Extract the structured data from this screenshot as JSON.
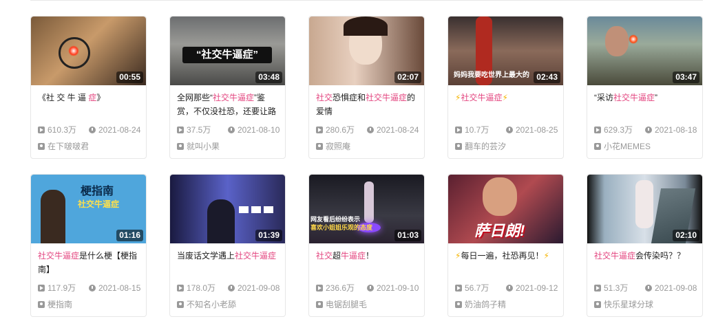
{
  "videos": [
    {
      "duration": "00:55",
      "title_parts": [
        {
          "t": "《社 交 牛 逼 "
        },
        {
          "t": "症",
          "h": true
        },
        {
          "t": "》"
        }
      ],
      "views": "610.3万",
      "date": "2021-08-24",
      "author": "在下啵啵君"
    },
    {
      "duration": "03:48",
      "thumb_caption": "“社交牛逼症”",
      "title_parts": [
        {
          "t": "全网那些“"
        },
        {
          "t": "社交牛逼症",
          "h": true
        },
        {
          "t": "”鉴赏，不仅没社恐，还要让路"
        }
      ],
      "views": "37.5万",
      "date": "2021-08-10",
      "author": "就叫小果"
    },
    {
      "duration": "02:07",
      "title_parts": [
        {
          "t": "社交",
          "h": true
        },
        {
          "t": "恐惧症和"
        },
        {
          "t": "社交牛逼症",
          "h": true
        },
        {
          "t": "的爱情"
        }
      ],
      "views": "280.6万",
      "date": "2021-08-24",
      "author": "寂照庵"
    },
    {
      "duration": "02:43",
      "thumb_caption": "妈妈我要吃世界上最大的",
      "title_parts": [
        {
          "t": "⚡",
          "b": true
        },
        {
          "t": "社交牛逼症",
          "h": true
        },
        {
          "t": "⚡",
          "b": true
        }
      ],
      "views": "10.7万",
      "date": "2021-08-25",
      "author": "翻车的芸汐"
    },
    {
      "duration": "03:47",
      "title_parts": [
        {
          "t": "“采访"
        },
        {
          "t": "社交牛逼症",
          "h": true
        },
        {
          "t": "”"
        }
      ],
      "views": "629.3万",
      "date": "2021-08-18",
      "author": "小花MEMES"
    },
    {
      "duration": "01:16",
      "thumb_caption": "梗指南",
      "thumb_caption2": "社交牛逼症",
      "title_parts": [
        {
          "t": "社交牛逼症",
          "h": true
        },
        {
          "t": "是什么梗【梗指南】"
        }
      ],
      "views": "117.9万",
      "date": "2021-08-15",
      "author": "梗指南"
    },
    {
      "duration": "01:39",
      "title_parts": [
        {
          "t": "当废话文学遇上"
        },
        {
          "t": "社交牛逼症",
          "h": true
        }
      ],
      "views": "178.0万",
      "date": "2021-09-08",
      "author": "不知名小老舔"
    },
    {
      "duration": "01:03",
      "thumb_caption": "网友看后纷纷表示",
      "thumb_caption2": "喜欢小姐姐乐观的态度",
      "title_parts": [
        {
          "t": "社交",
          "h": true
        },
        {
          "t": "超"
        },
        {
          "t": "牛逼症",
          "h": true
        },
        {
          "t": "！"
        }
      ],
      "views": "236.6万",
      "date": "2021-09-10",
      "author": "电锯刮腿毛"
    },
    {
      "duration": "",
      "thumb_caption": "萨日朗!",
      "title_parts": [
        {
          "t": "⚡",
          "b": true
        },
        {
          "t": "每日一遍，社恐再见！"
        },
        {
          "t": "⚡",
          "b": true
        }
      ],
      "views": "56.7万",
      "date": "2021-09-12",
      "author": "奶油鸽子精"
    },
    {
      "duration": "02:10",
      "title_parts": [
        {
          "t": "社交牛逼症",
          "h": true
        },
        {
          "t": "会传染吗？？"
        }
      ],
      "views": "51.3万",
      "date": "2021-09-08",
      "author": "快乐星球分球"
    }
  ]
}
